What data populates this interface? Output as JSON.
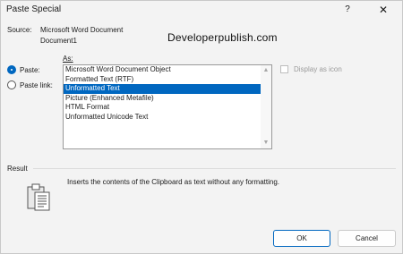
{
  "window": {
    "title": "Paste Special",
    "help_label": "?",
    "close_label": "✕"
  },
  "source": {
    "label": "Source:",
    "line1": "Microsoft Word Document",
    "line2": "Document1"
  },
  "watermark": "Developerpublish.com",
  "as_label": "As:",
  "options": [
    {
      "label": "Paste:",
      "selected": true
    },
    {
      "label": "Paste link:",
      "selected": false
    }
  ],
  "list": {
    "items": [
      "Microsoft Word Document Object",
      "Formatted Text (RTF)",
      "Unformatted Text",
      "Picture (Enhanced Metafile)",
      "HTML Format",
      "Unformatted Unicode Text"
    ],
    "selected_index": 2
  },
  "display_as_icon": {
    "label": "Display as icon",
    "checked": false,
    "enabled": false
  },
  "result": {
    "label": "Result",
    "text": "Inserts the contents of the Clipboard as text without any formatting."
  },
  "buttons": {
    "ok": "OK",
    "cancel": "Cancel"
  },
  "colors": {
    "accent": "#0067c0"
  }
}
